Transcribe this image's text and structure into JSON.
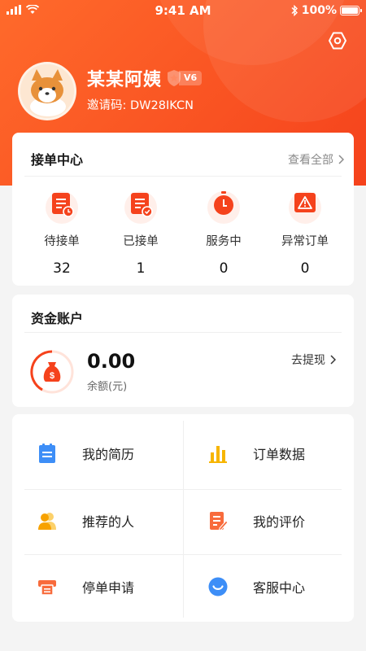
{
  "status_bar": {
    "time": "9:41 AM",
    "battery": "100%"
  },
  "profile": {
    "name": "某某阿姨",
    "level": "V6",
    "invite_label": "邀请码:",
    "invite_code": "DW28IKCN"
  },
  "orders": {
    "title": "接单中心",
    "view_all": "查看全部",
    "stats": [
      {
        "label": "待接单",
        "value": "32",
        "icon": "pending-order-icon"
      },
      {
        "label": "已接单",
        "value": "1",
        "icon": "accepted-order-icon"
      },
      {
        "label": "服务中",
        "value": "0",
        "icon": "in-service-timer-icon"
      },
      {
        "label": "异常订单",
        "value": "0",
        "icon": "abnormal-order-warning-icon"
      }
    ]
  },
  "fund": {
    "title": "资金账户",
    "amount": "0.00",
    "balance_label": "余额(元)",
    "withdraw": "去提现"
  },
  "menu": [
    {
      "label": "我的简历",
      "icon": "resume-icon"
    },
    {
      "label": "订单数据",
      "icon": "bar-chart-icon"
    },
    {
      "label": "推荐的人",
      "icon": "people-icon"
    },
    {
      "label": "我的评价",
      "icon": "review-edit-icon"
    },
    {
      "label": "停单申请",
      "icon": "printer-stop-icon"
    },
    {
      "label": "客服中心",
      "icon": "customer-service-icon"
    }
  ],
  "colors": {
    "brand": "#f5421c",
    "accent_orange": "#ff6a2b",
    "blue": "#3d8ef7",
    "yellow": "#f7b500"
  }
}
